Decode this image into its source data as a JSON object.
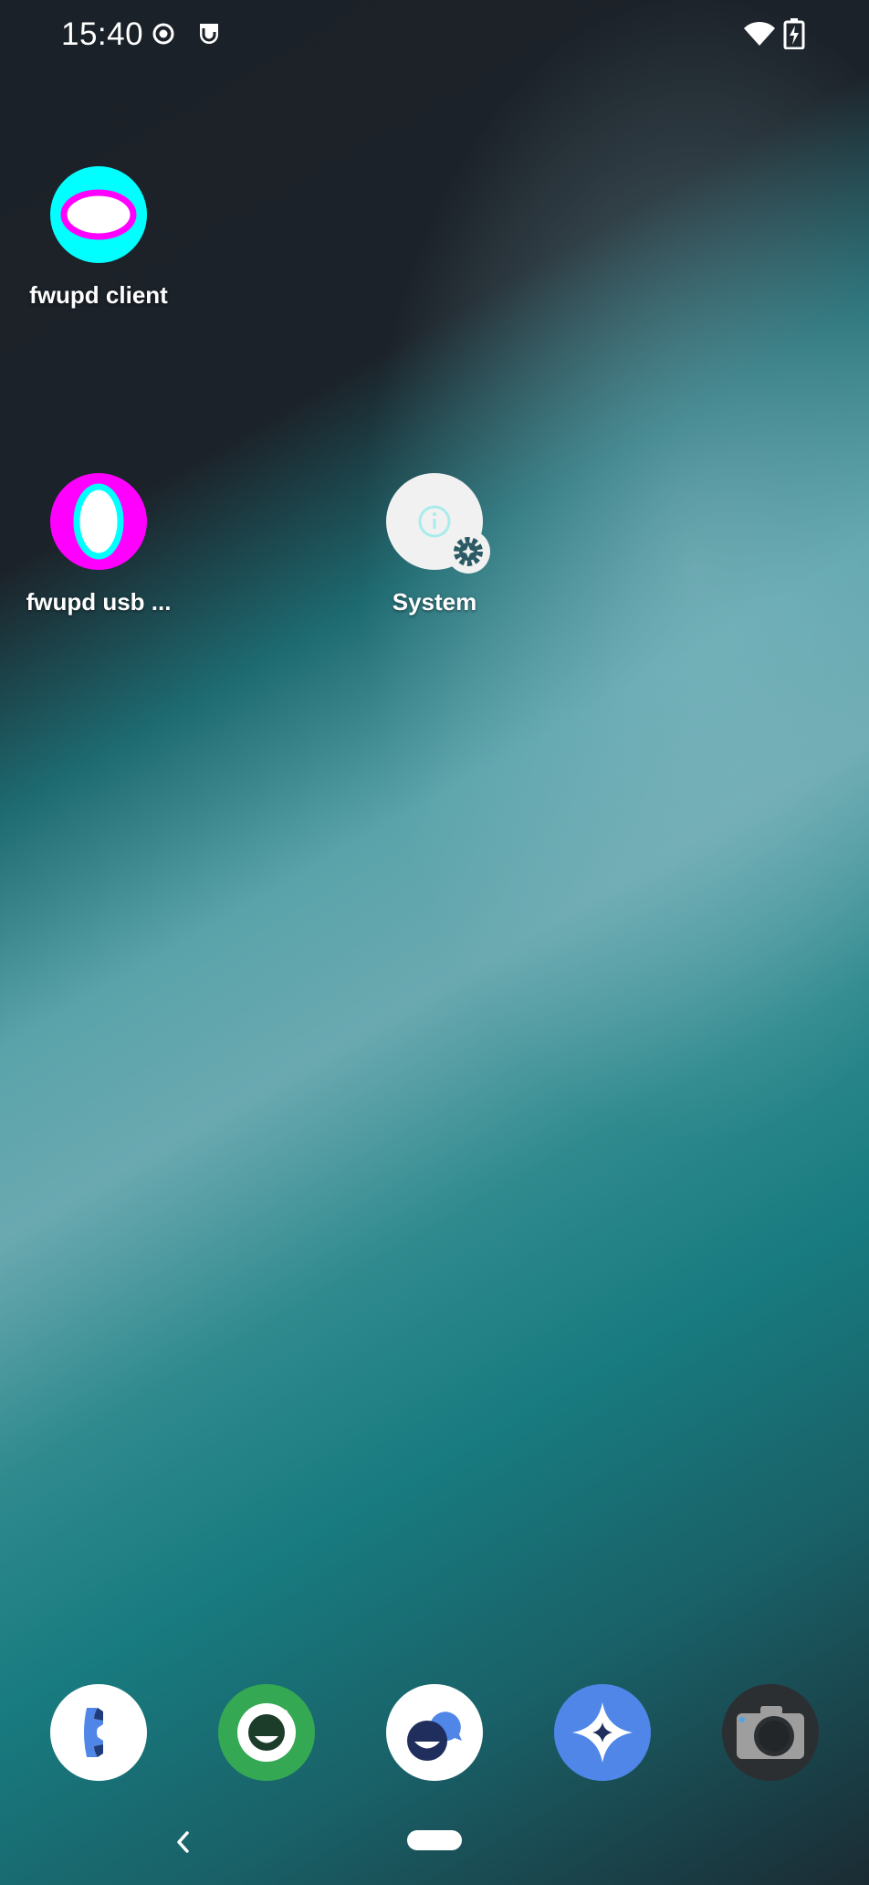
{
  "status_bar": {
    "time": "15:40",
    "icons": [
      "record-icon",
      "notification-app-icon",
      "wifi-icon",
      "battery-charging-icon"
    ]
  },
  "home_apps": [
    {
      "label": "fwupd client",
      "icon": "fwupd-client-icon"
    },
    {
      "label": "fwupd usb ...",
      "icon": "fwupd-usb-icon"
    },
    {
      "label": "System",
      "icon": "system-info-icon"
    }
  ],
  "dock": [
    {
      "icon": "phone-icon"
    },
    {
      "icon": "messages-icon"
    },
    {
      "icon": "chat-icon"
    },
    {
      "icon": "assistant-icon"
    },
    {
      "icon": "camera-icon"
    }
  ],
  "nav": {
    "back_icon": "back-icon",
    "home_icon": "home-pill"
  },
  "colors": {
    "fwupd_client_bg": "#00ffff",
    "fwupd_client_ring": "#ff00ff",
    "fwupd_usb_bg": "#ff00ff",
    "fwupd_usb_ring": "#00ffff",
    "system_bg": "#f1f1f1",
    "messages_bg": "#34a853",
    "assistant_bg": "#4f86e8",
    "camera_bg": "#2b2f31"
  }
}
